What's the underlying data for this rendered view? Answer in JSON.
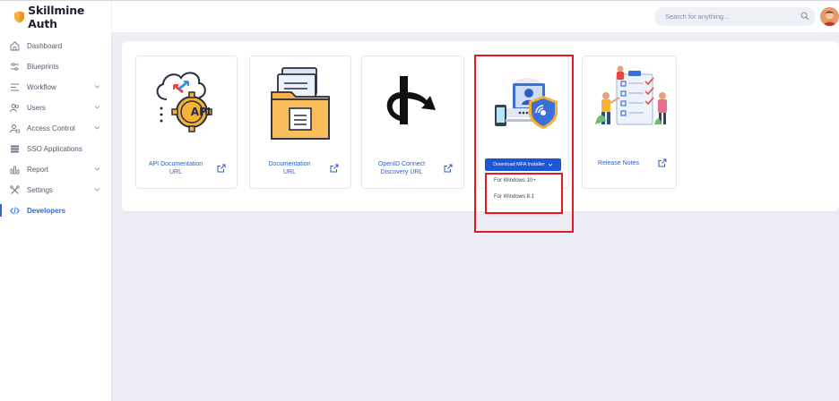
{
  "brand": {
    "name": "Skillmine Auth"
  },
  "search": {
    "placeholder": "Search for anything..."
  },
  "sidebar": {
    "items": [
      {
        "label": "Dashboard"
      },
      {
        "label": "Blueprints"
      },
      {
        "label": "Workflow"
      },
      {
        "label": "Users"
      },
      {
        "label": "Access Control"
      },
      {
        "label": "SSO Applications"
      },
      {
        "label": "Report"
      },
      {
        "label": "Settings"
      },
      {
        "label": "Developers"
      }
    ]
  },
  "cards": {
    "api": {
      "label_line1": "API Documentation",
      "label_line2": "URL",
      "badge": "API"
    },
    "docs": {
      "label_line1": "Documentation",
      "label_line2": "URL"
    },
    "openid": {
      "label_line1": "OpenID Connect",
      "label_line2": "Discovery URL"
    },
    "mfa": {
      "button_label": "Download MFA Installer",
      "options": [
        "For Windows 10+",
        "For Windows 8.1"
      ]
    },
    "release": {
      "label": "Release Notes"
    }
  },
  "colors": {
    "accent": "#2d6ad6",
    "highlight": "#e01b24",
    "brand_shield": "#f5b335"
  }
}
